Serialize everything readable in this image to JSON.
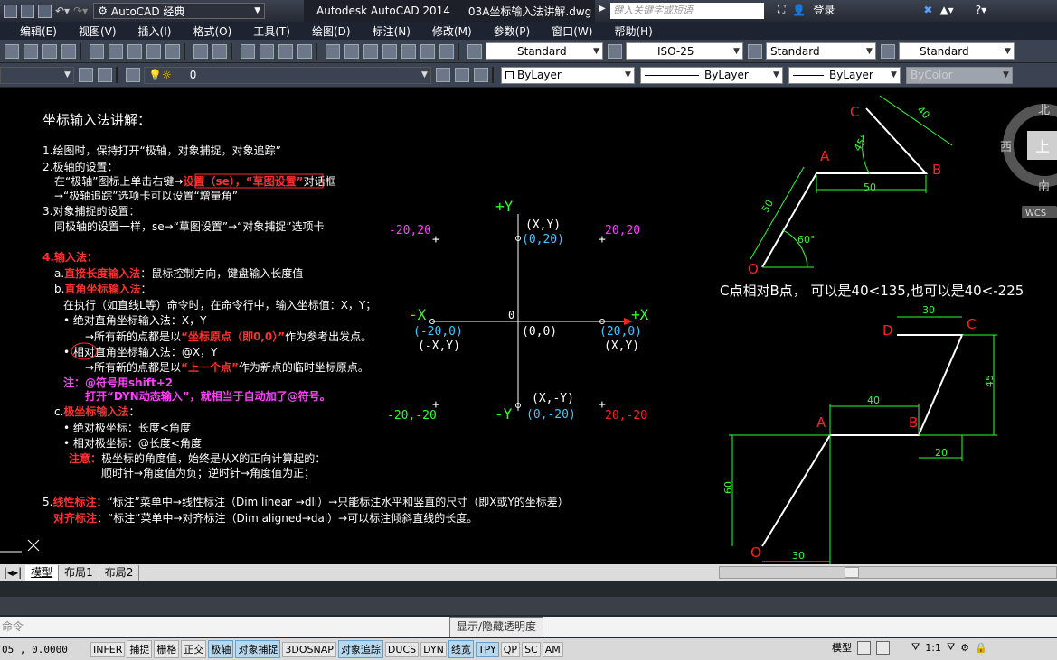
{
  "titlebar": {
    "workspace": "AutoCAD 经典",
    "app": "Autodesk AutoCAD 2014",
    "file": "03A坐标输入法讲解.dwg",
    "search_placeholder": "键入关键字或短语",
    "login": "登录"
  },
  "menu": [
    "编辑(E)",
    "视图(V)",
    "插入(I)",
    "格式(O)",
    "工具(T)",
    "绘图(D)",
    "标注(N)",
    "修改(M)",
    "参数(P)",
    "窗口(W)",
    "帮助(H)"
  ],
  "toolbar": {
    "text_style": "Standard",
    "dim_style": "ISO-25",
    "table_style": "Standard",
    "mleader_style": "Standard",
    "layer": "0",
    "color": "ByLayer",
    "linetype": "ByLayer",
    "lineweight": "ByLayer",
    "plotstyle": "ByColor"
  },
  "notes": {
    "heading": "坐标输入法讲解：",
    "l1": "1.绘图时，保持打开“极轴，对象捕捉，对象追踪”",
    "l2": "2.极轴的设置：",
    "l3a": "在“极轴”图标上单击右键→",
    "l3b": "设置（se），“草图设置”",
    "l3c": "对话框",
    "l4": "→“极轴追踪”选项卡可以设置“增量角”",
    "l5": "3.对象捕捉的设置：",
    "l6": "同极轴的设置一样，se→“草图设置”→“对象捕捉”选项卡",
    "l7": "4.输入法：",
    "l8a": "a.",
    "l8b": "直接长度输入法",
    "l8c": "：鼠标控制方向，键盘输入长度值",
    "l9a": "b.",
    "l9b": "直角坐标输入法",
    "l9c": "：",
    "l10": "在执行（如直线L等）命令时，在命令行中，输入坐标值：X，Y；",
    "l11": "• 绝对直角坐标输入法：X，Y",
    "l12a": "→所有新的点都是以",
    "l12b": "“坐标原点（即0,0）”",
    "l12c": "作为参考出发点。",
    "l13": "• 相对直角坐标输入法：@X，Y",
    "l14a": "→所有新的点都是以",
    "l14b": "“上一个点”",
    "l14c": "作为新点的临时坐标原点。",
    "l15": "注：@符号用shift+2",
    "l16": "打开“DYN动态输入”，就相当于自动加了@符号。",
    "l17a": "c.",
    "l17b": "极坐标输入法",
    "l17c": "：",
    "l18": "• 绝对极坐标：长度<角度",
    "l19": "• 相对极坐标：@长度<角度",
    "l20a": "注意：",
    "l20b": "极坐标的角度值，始终是从X的正向计算起的：",
    "l21": "顺时针→角度值为负；逆时针→角度值为正；",
    "l22a": "5.",
    "l22b": "线性标注",
    "l22c": "：“标注”菜单中→线性标注（Dim linear →dli）→只能标注水平和竖直的尺寸（即X或Y的坐标差）",
    "l23a": "对齐标注",
    "l23b": "：“标注”菜单中→对齐标注（Dim aligned→dal）→可以标注倾斜直线的长度。"
  },
  "axes": {
    "py": "+Y",
    "ny": "-Y",
    "px": "+X",
    "nx": "-X",
    "origin": "0",
    "xy": "(X,Y)",
    "p020": "(0,20)",
    "m2020": "-20,20",
    "p2020": "20,20",
    "m200": "(-20,0)",
    "mxy": "(-X,Y)",
    "o00": "(0,0)",
    "p200": "(20,0)",
    "xy2": "(X,Y)",
    "mxmy": "(X,-Y)",
    "pm20": "(0,-20)",
    "mm2020": "-20,-20",
    "pm2020": "20,-20"
  },
  "fig1": {
    "c": "C",
    "a": "A",
    "b": "B",
    "o": "O",
    "d40": "40",
    "d50h": "50",
    "d50s": "50",
    "a45": "45°",
    "a60": "60°",
    "caption": "C点相对B点， 可以是40<135,也可以是40<-225"
  },
  "fig2": {
    "d": "D",
    "c": "C",
    "a": "A",
    "b": "B",
    "o": "O",
    "d30t": "30",
    "d45": "45",
    "d40": "40",
    "d20": "20",
    "d60": "60",
    "d30b": "30"
  },
  "compass": {
    "n": "北",
    "w": "西",
    "top": "上",
    "s": "南",
    "wcs": "WCS"
  },
  "tabs": [
    "模型",
    "布局1",
    "布局2"
  ],
  "cmd": {
    "prompt": "命令"
  },
  "tooltip": "显示/隐藏透明度",
  "status": {
    "coord": "05 , 0.0000",
    "buttons": [
      "INFER",
      "捕捉",
      "栅格",
      "正交",
      "极轴",
      "对象捕捉",
      "3DOSNAP",
      "对象追踪",
      "DUCS",
      "DYN",
      "线宽",
      "TPY",
      "QP",
      "SC",
      "AM"
    ],
    "model": "模型",
    "scale": "1:1"
  }
}
